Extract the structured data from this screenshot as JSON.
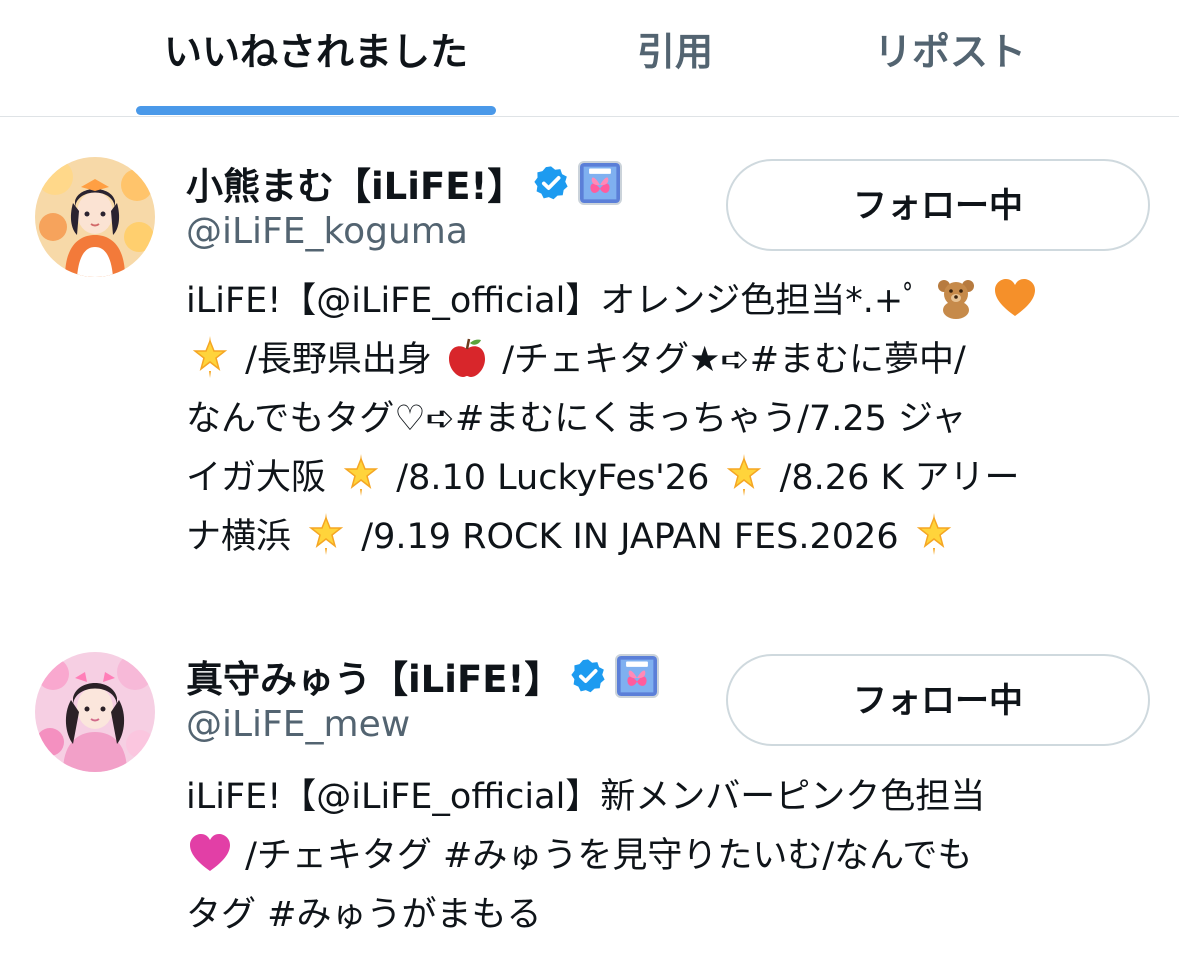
{
  "tabs": [
    {
      "label": "いいねされました",
      "active": true
    },
    {
      "label": "引用",
      "active": false
    },
    {
      "label": "リポスト",
      "active": false
    }
  ],
  "users": [
    {
      "display_name": "小熊まむ【iLiFE!】",
      "handle": "@iLiFE_koguma",
      "follow_label": "フォロー中",
      "bio_segments": {
        "s1": "iLiFE!【@iLiFE_official】オレンジ色担当*.+ﾟ",
        "s2": "/長野県出身",
        "s3": "/チェキタグ★➪#まむに夢中/",
        "s4": "なんでもタグ♡➪#まむにくまっちゃう/7.25 ジャ",
        "s5": "イガ大阪",
        "s6": "/8.10 LuckyFes'26 ",
        "s7": "/8.26 K アリー",
        "s8": "ナ横浜",
        "s9": "/9.19 ROCK IN JAPAN FES.2026"
      },
      "emoji": [
        "teddy-bear",
        "orange-heart",
        "glowing-star",
        "red-apple"
      ]
    },
    {
      "display_name": "真守みゅう【iLiFE!】",
      "handle": "@iLiFE_mew",
      "follow_label": "フォロー中",
      "bio_segments": {
        "s1": "iLiFE!【@iLiFE_official】新メンバーピンク色担当",
        "s2": "/チェキタグ #みゅうを見守りたいむ/なんでも",
        "s3": "タグ #みゅうがまもる"
      },
      "emoji": [
        "pink-heart"
      ]
    }
  ],
  "colors": {
    "accent": "#4a99e9",
    "verified": "#1d9bf0",
    "muted_text": "#536471",
    "border": "#cfd9de"
  }
}
